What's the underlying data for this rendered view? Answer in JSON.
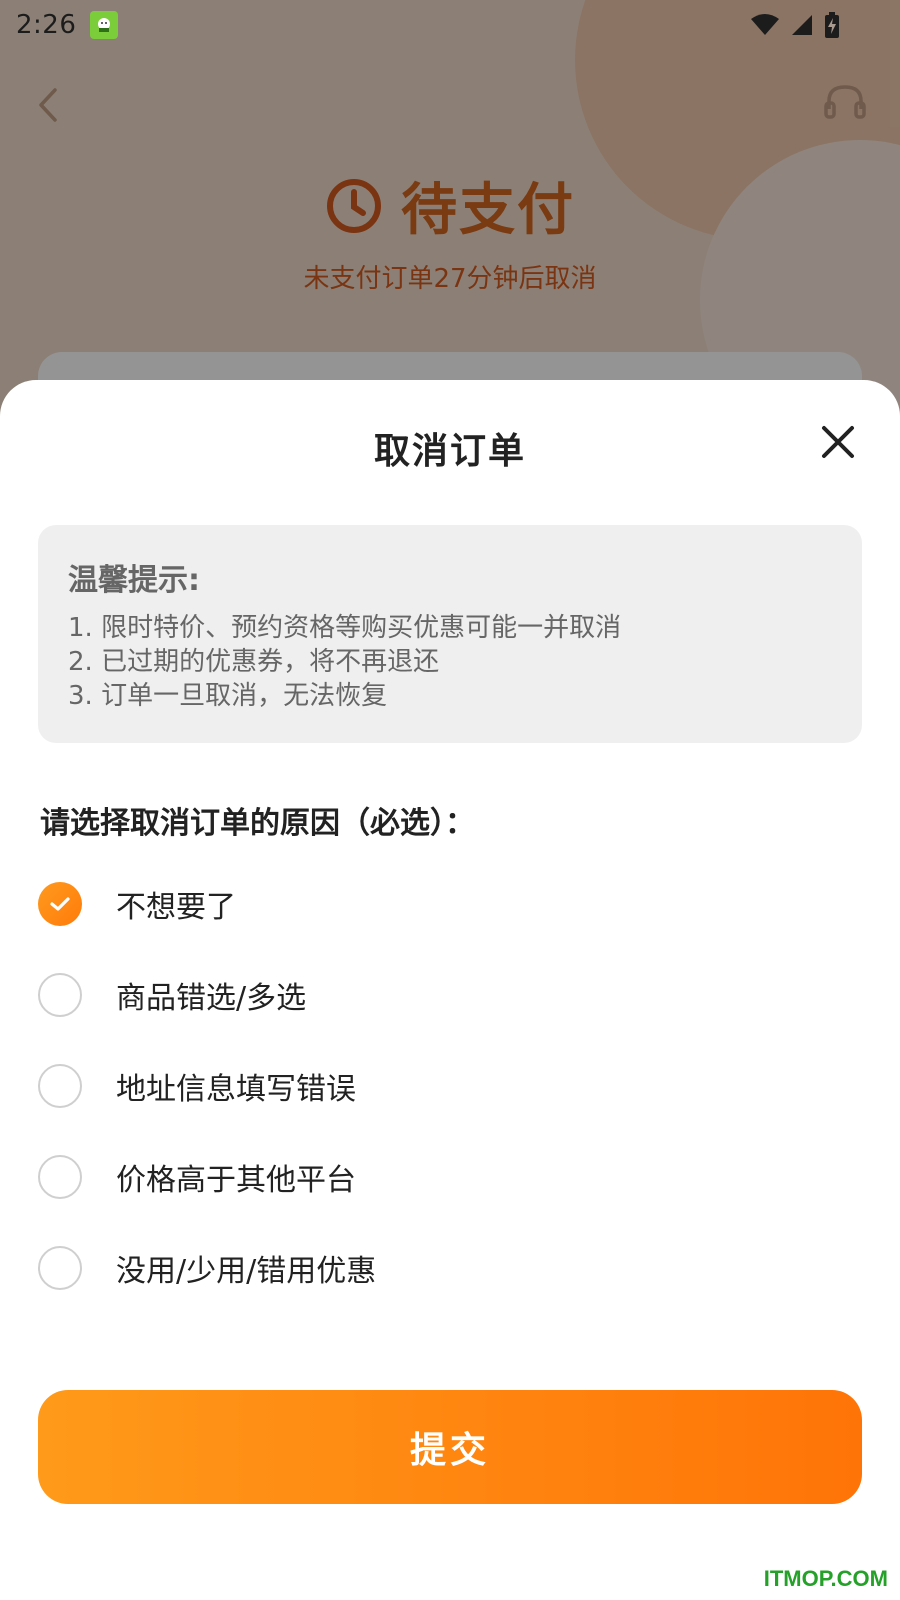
{
  "status_bar": {
    "time": "2:26",
    "app_icon": "android-app-icon",
    "icons": [
      "wifi-icon",
      "signal-icon",
      "battery-charging-icon"
    ]
  },
  "background": {
    "header": {
      "back_icon": "chevron-left-icon",
      "service_icon": "headset-icon",
      "status_icon": "clock-icon",
      "status_title": "待支付",
      "status_subtitle": "未支付订单27分钟后取消"
    }
  },
  "sheet": {
    "title": "取消订单",
    "close_icon": "close-icon",
    "tips": {
      "title": "温馨提示:",
      "lines": [
        "1. 限时特价、预约资格等购买优惠可能一并取消",
        "2. 已过期的优惠券，将不再退还",
        "3. 订单一旦取消，无法恢复"
      ]
    },
    "reason_title": "请选择取消订单的原因（必选）：",
    "reasons": [
      {
        "label": "不想要了",
        "selected": true
      },
      {
        "label": "商品错选/多选",
        "selected": false
      },
      {
        "label": "地址信息填写错误",
        "selected": false
      },
      {
        "label": "价格高于其他平台",
        "selected": false
      },
      {
        "label": "没用/少用/错用优惠",
        "selected": false
      }
    ],
    "submit_label": "提交"
  },
  "watermark": "ITMOP.COM",
  "colors": {
    "accent": "#ff8a10",
    "status_text": "#7a3412",
    "tips_bg": "#efefef",
    "watermark": "#25a12a"
  }
}
